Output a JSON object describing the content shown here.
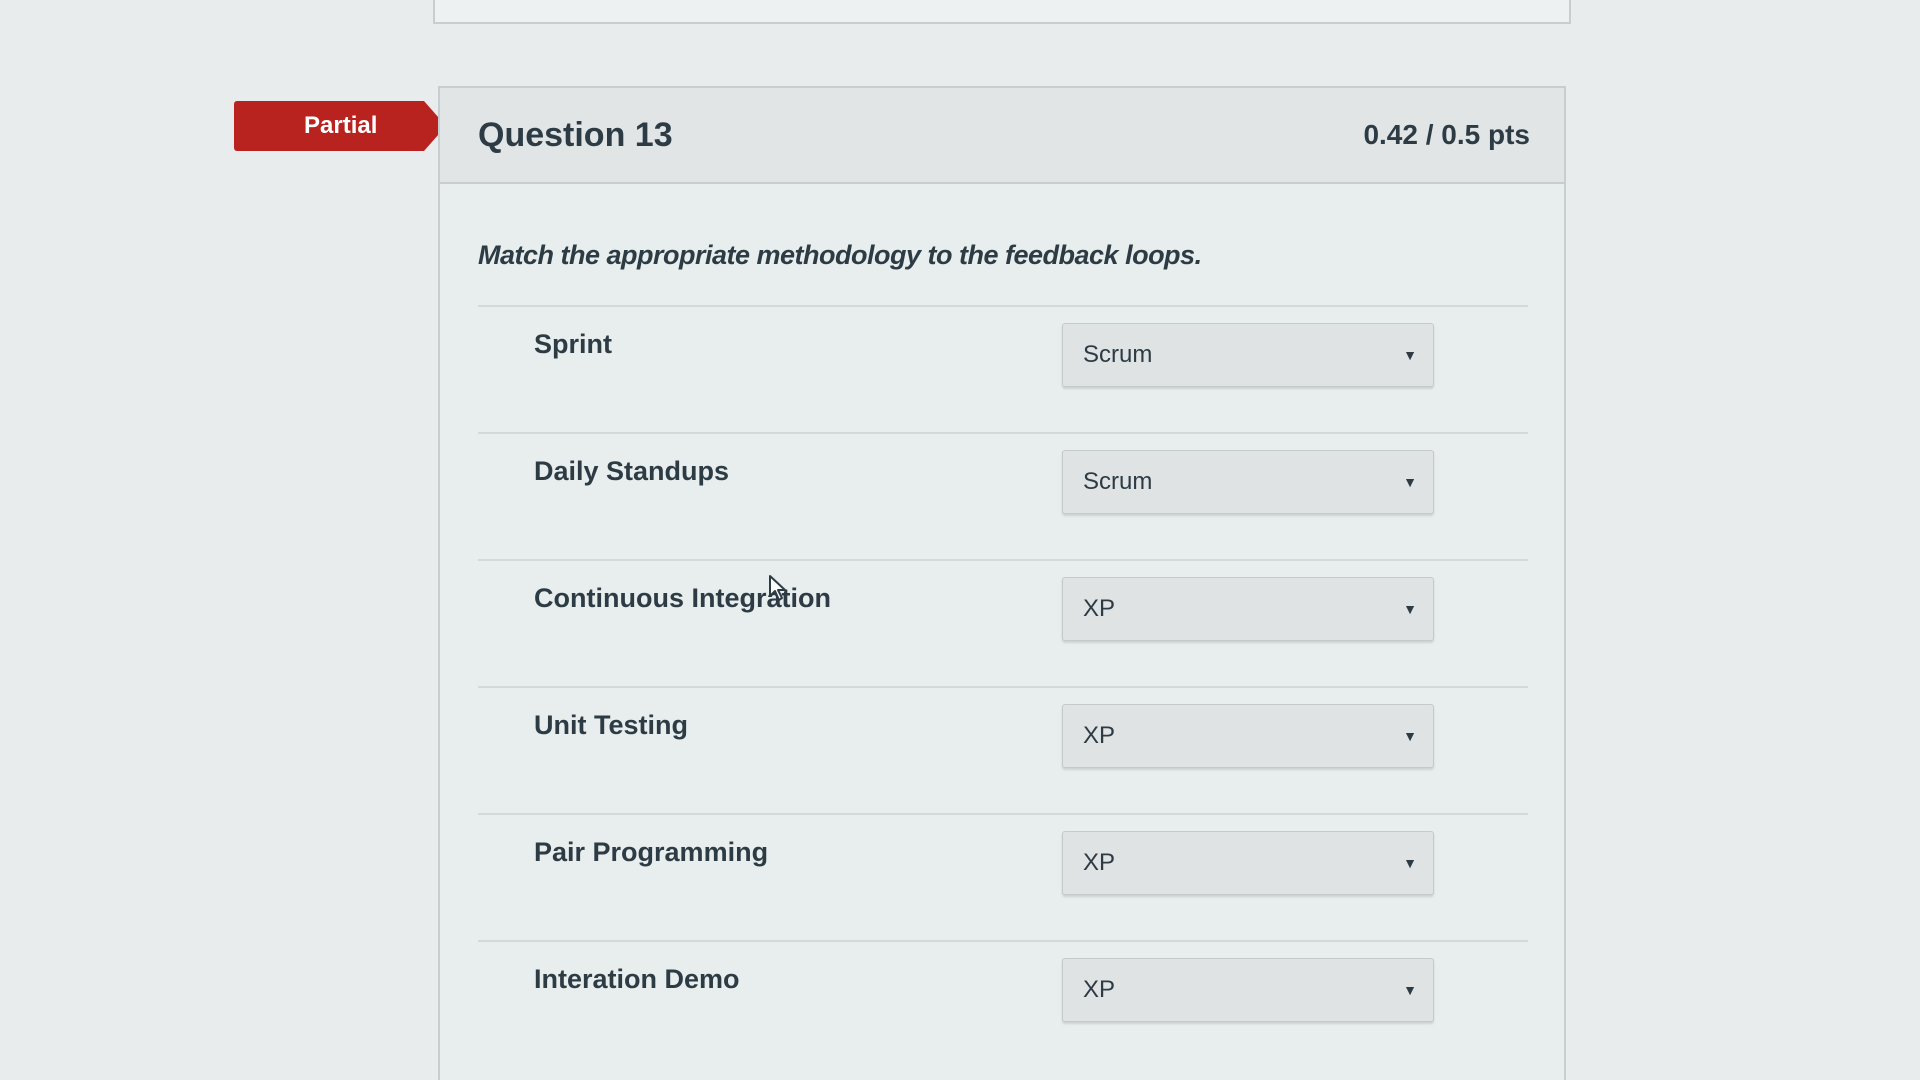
{
  "badge": {
    "label": "Partial"
  },
  "question": {
    "title": "Question 13",
    "points": "0.42 / 0.5 pts",
    "prompt": "Match the appropriate methodology to the feedback loops."
  },
  "matches": [
    {
      "label": "Sprint",
      "selected": "Scrum"
    },
    {
      "label": "Daily Standups",
      "selected": "Scrum"
    },
    {
      "label": "Continuous Integration",
      "selected": "XP"
    },
    {
      "label": "Unit Testing",
      "selected": "XP"
    },
    {
      "label": "Pair Programming",
      "selected": "XP"
    },
    {
      "label": "Interation Demo",
      "selected": "XP"
    }
  ],
  "icons": {
    "dropdown": "chevron-down-icon",
    "cursor": "mouse-pointer-icon"
  },
  "colors": {
    "badge": "#b8231f",
    "text": "#2d3b45",
    "border": "#c7cdd1"
  }
}
